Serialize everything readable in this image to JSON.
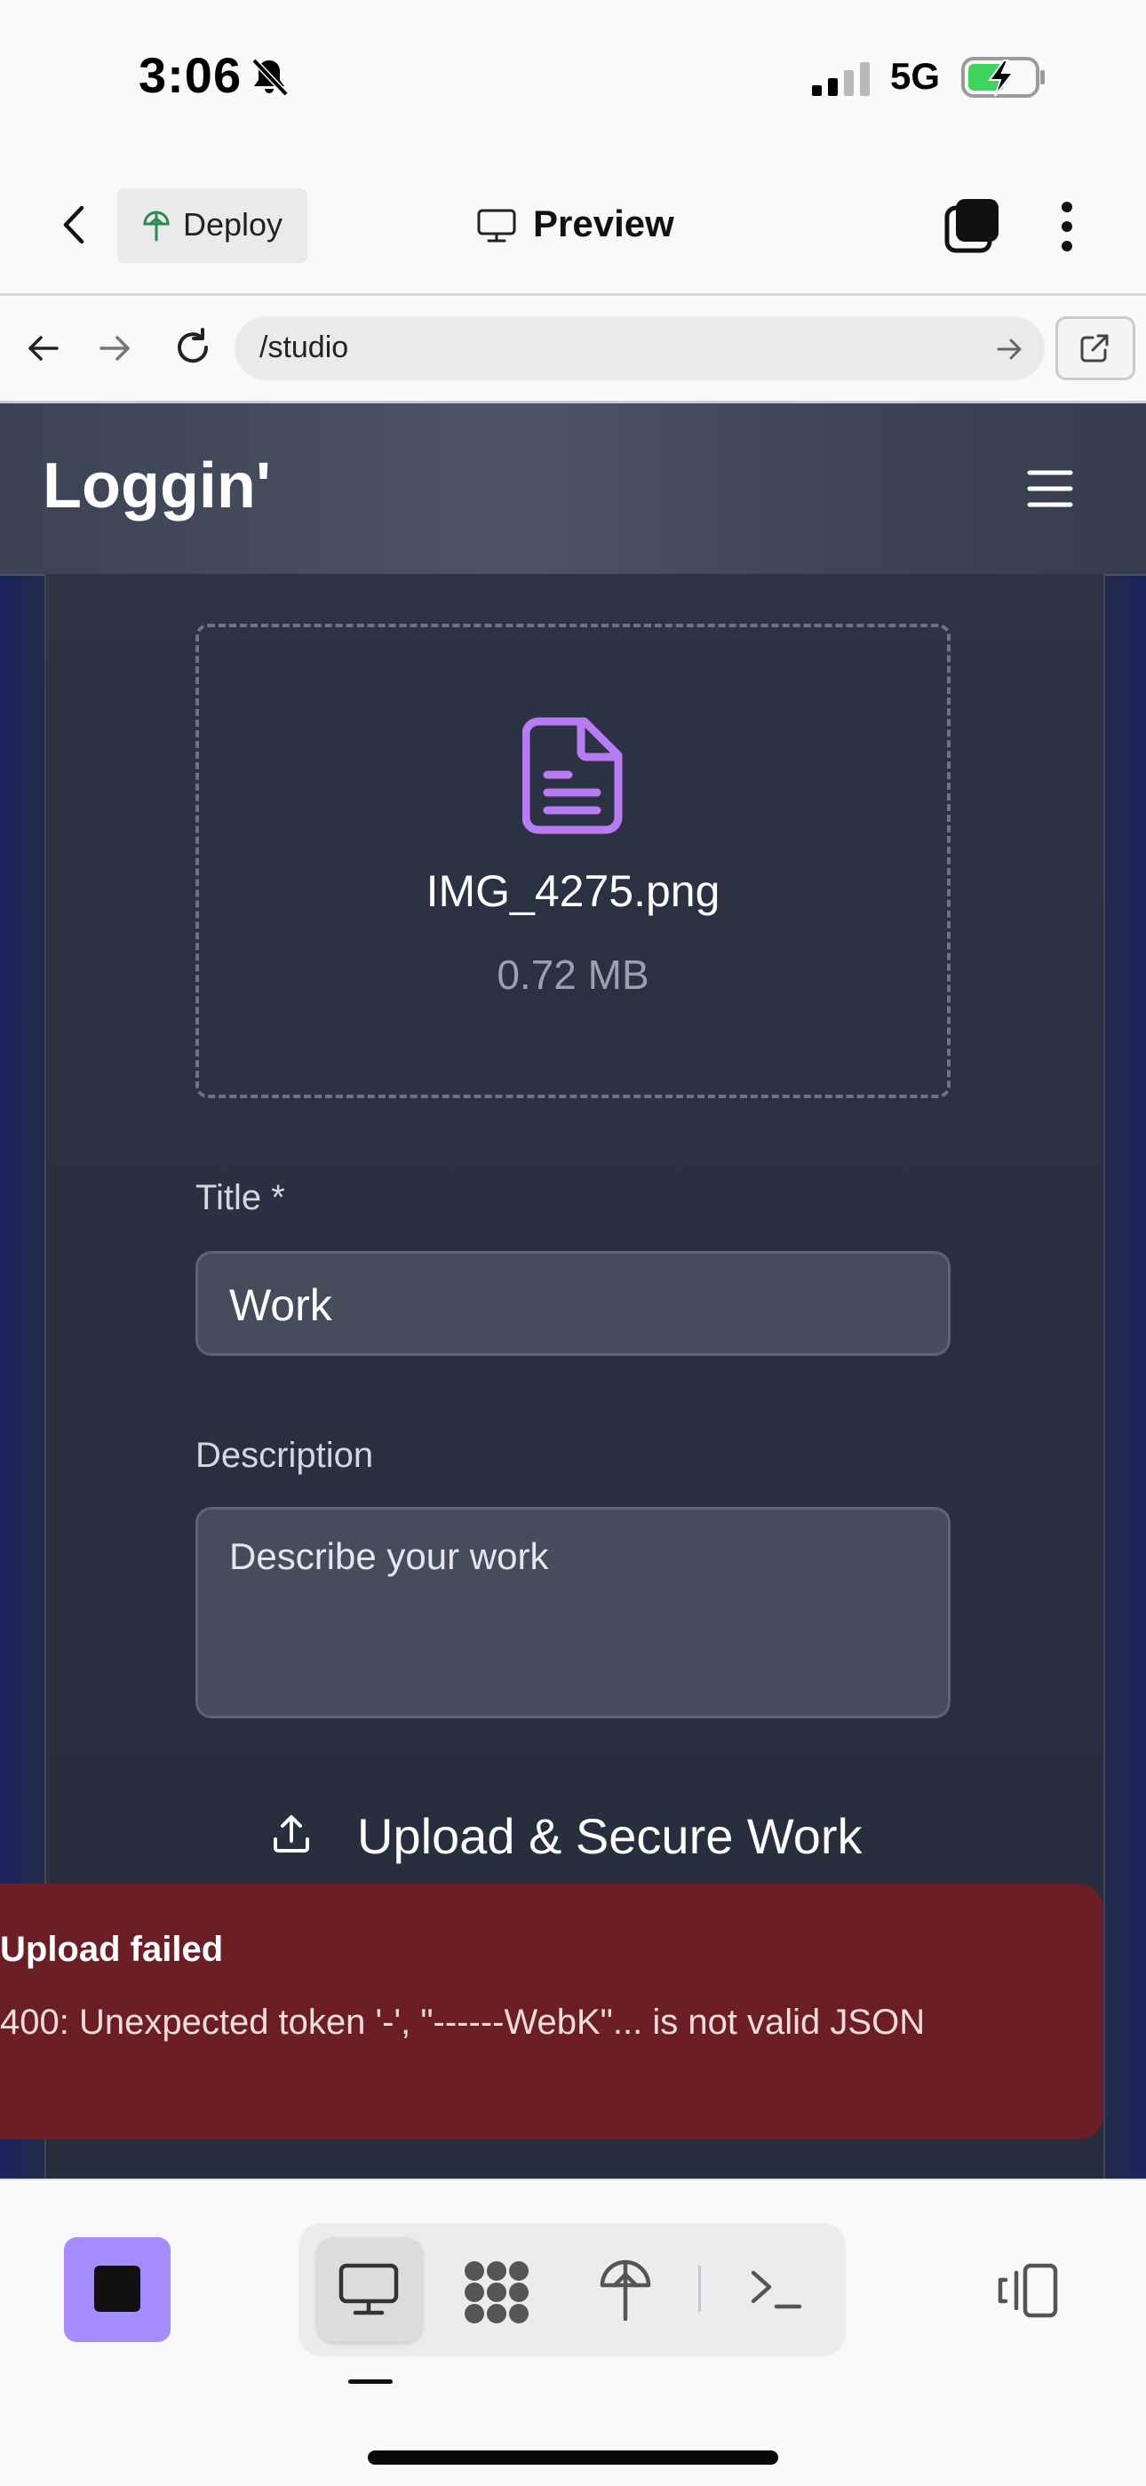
{
  "status_bar": {
    "time": "3:06",
    "network": "5G"
  },
  "top_bar": {
    "deploy_label": "Deploy",
    "preview_title": "Preview"
  },
  "browser": {
    "url": "/studio"
  },
  "site": {
    "logo": "Loggin'"
  },
  "upload_form": {
    "file_name": "IMG_4275.png",
    "file_size": "0.72 MB",
    "title_label": "Title *",
    "title_value": "Work",
    "description_label": "Description",
    "description_placeholder": "Describe your work",
    "submit_label": "Upload & Secure Work"
  },
  "toast": {
    "title": "Upload failed",
    "message": "400: Unexpected token '-', \"------WebK\"... is not valid JSON"
  },
  "colors": {
    "accent_purple": "#a58cff",
    "file_icon": "#b87cf2",
    "error_bg": "#6b1f24",
    "deploy_green": "#2f8a4e",
    "battery_green": "#3dd65c"
  },
  "icons": {
    "status": [
      "bell-slash-icon",
      "signal-icon",
      "battery-charging-icon"
    ],
    "toolbar": [
      "preview-monitor-icon",
      "apps-icon",
      "deploy-icon",
      "shell-icon",
      "layout-icon"
    ]
  }
}
